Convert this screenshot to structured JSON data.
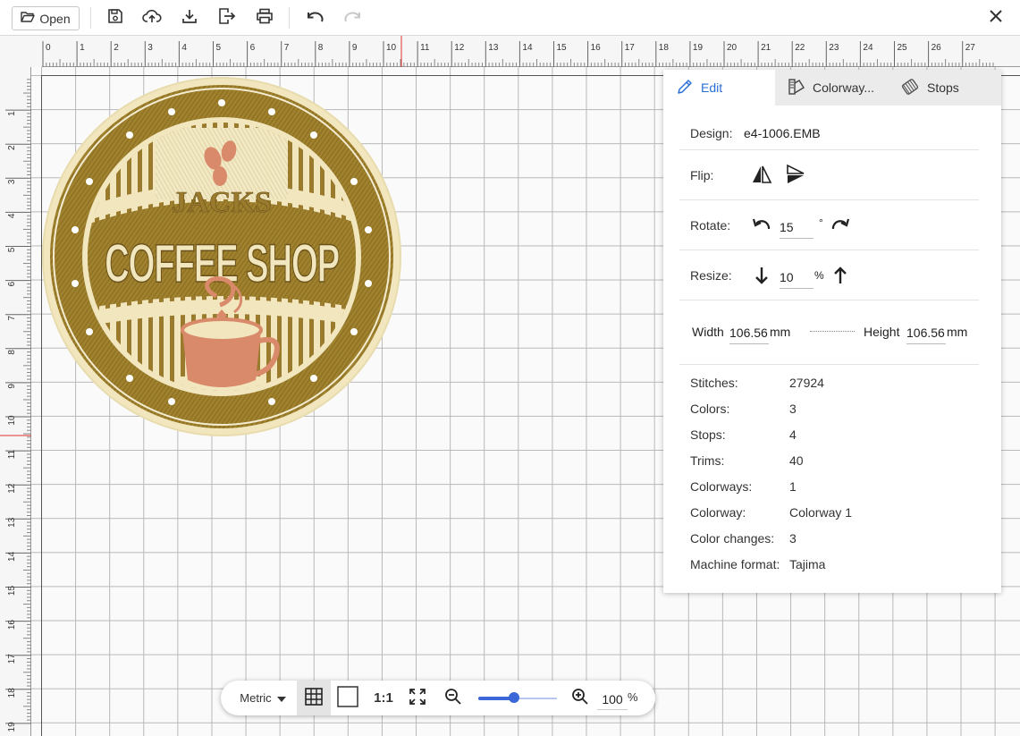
{
  "toolbar": {
    "open_label": "Open",
    "icons": [
      "folder-open-icon",
      "save-icon",
      "cloud-upload-icon",
      "download-icon",
      "export-icon",
      "print-icon",
      "undo-icon",
      "redo-icon",
      "close-icon"
    ]
  },
  "ruler": {
    "h_labels": [
      "0",
      "1",
      "2",
      "3",
      "4",
      "5",
      "6",
      "7",
      "8",
      "9",
      "10",
      "11",
      "12",
      "13",
      "14",
      "15",
      "16",
      "17",
      "18",
      "19",
      "20",
      "21",
      "22",
      "23",
      "24",
      "25",
      "26",
      "27"
    ],
    "v_labels": [
      "1",
      "2",
      "3",
      "4",
      "5",
      "6",
      "7",
      "8",
      "9",
      "10",
      "11",
      "12",
      "13",
      "14",
      "15",
      "16",
      "17",
      "18",
      "19"
    ],
    "marker_color": "#e03030"
  },
  "design": {
    "top_text": "JACKS",
    "main_text": "COFFEE SHOP",
    "colors": {
      "base": "#9a7a2c",
      "light": "#f1e6bd",
      "accent": "#d98a6a",
      "dark": "#6b521a"
    }
  },
  "panel": {
    "tabs": [
      {
        "label": "Edit",
        "icon": "pencil-icon"
      },
      {
        "label": "Colorway...",
        "icon": "palette-icon"
      },
      {
        "label": "Stops",
        "icon": "thread-spool-icon"
      }
    ],
    "design_label": "Design:",
    "design_value": "e4-1006.EMB",
    "flip_label": "Flip:",
    "rotate_label": "Rotate:",
    "rotate_value": "15",
    "rotate_unit": "°",
    "resize_label": "Resize:",
    "resize_value": "10",
    "resize_unit": "%",
    "width_label": "Width",
    "width_value": "106.56",
    "width_unit": "mm",
    "height_label": "Height",
    "height_value": "106.56",
    "height_unit": "mm",
    "stats": [
      {
        "label": "Stitches:",
        "value": "27924"
      },
      {
        "label": "Colors:",
        "value": "3"
      },
      {
        "label": "Stops:",
        "value": "4"
      },
      {
        "label": "Trims:",
        "value": "40"
      },
      {
        "label": "Colorways:",
        "value": "1"
      },
      {
        "label": "Colorway:",
        "value": "Colorway 1"
      },
      {
        "label": "Color changes:",
        "value": "3"
      },
      {
        "label": "Machine format:",
        "value": "Tajima"
      }
    ],
    "accent_color": "#2a6fd6"
  },
  "bottom_bar": {
    "units_label": "Metric",
    "ratio_label": "1:1",
    "zoom_value": "100",
    "zoom_unit": "%",
    "zoom_slider_fraction": 0.45
  }
}
